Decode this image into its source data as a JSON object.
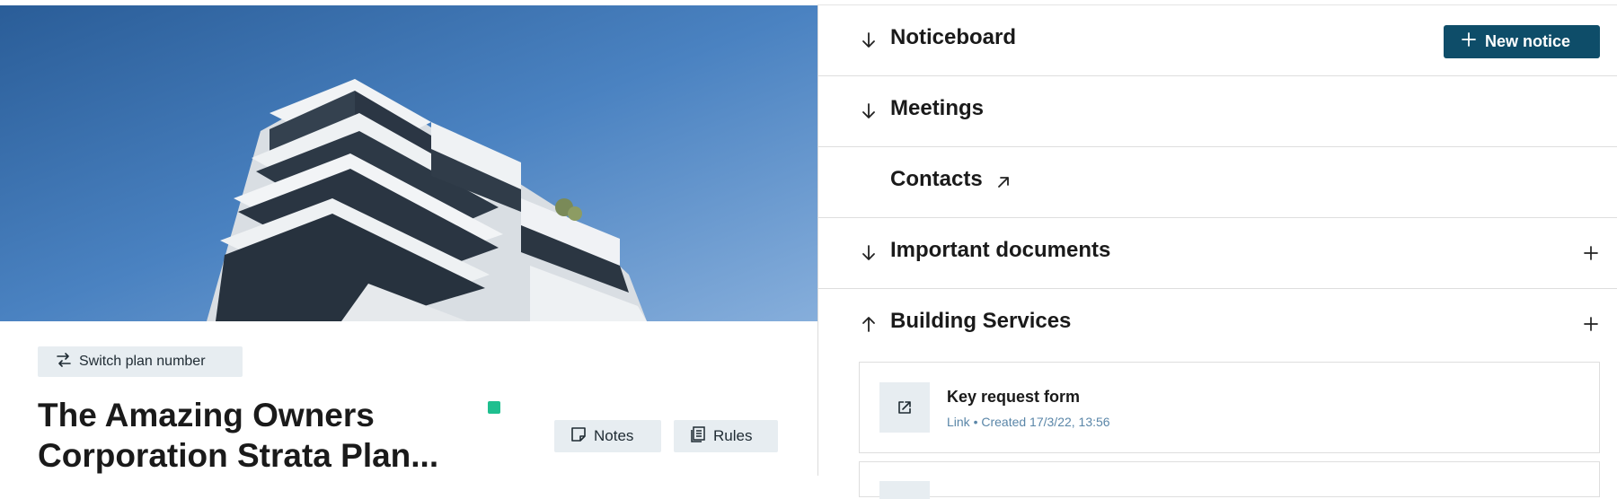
{
  "plan": {
    "switch_label": "Switch plan number",
    "title": "The Amazing Owners Corporation Strata Plan...",
    "notes_label": "Notes",
    "rules_label": "Rules",
    "status_color": "#1fbf8f"
  },
  "hero": {
    "icon": "building-photo"
  },
  "sections": [
    {
      "title": "Noticeboard",
      "state": "collapsed",
      "chevron": "arrow-down-icon"
    },
    {
      "title": "Meetings",
      "state": "collapsed",
      "chevron": "arrow-down-icon"
    },
    {
      "title": "Contacts",
      "state": "external-link",
      "chevron": "arrow-up-right-icon"
    },
    {
      "title": "Important documents",
      "state": "collapsed",
      "chevron": "arrow-down-icon"
    },
    {
      "title": "Building Services",
      "state": "expanded",
      "chevron": "arrow-up-icon"
    }
  ],
  "noticeboard": {
    "new_notice_label": "New notice"
  },
  "building_services": {
    "items": [
      {
        "title": "Key request form",
        "meta": "Link • Created 17/3/22, 13:56",
        "icon": "external-link-icon"
      }
    ]
  },
  "colors": {
    "primary": "#0e4d69",
    "button_bg": "#e7edf1",
    "meta_text": "#5a86a8"
  }
}
